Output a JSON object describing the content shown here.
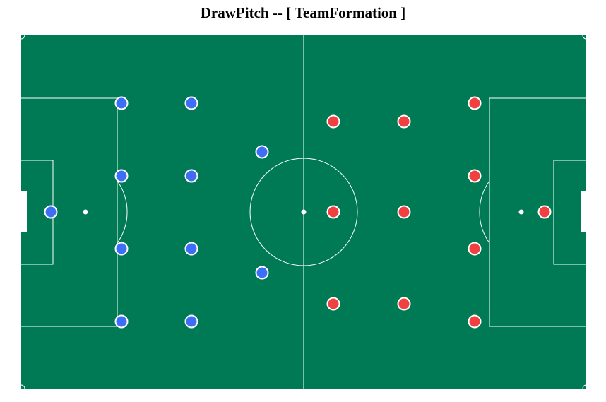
{
  "title": "DrawPitch -- [ TeamFormation ]",
  "colors": {
    "pitch": "#007a55",
    "lines": "#ffffff",
    "home_team": "#3d6ef5",
    "away_team": "#f04040",
    "page_background": "#ffffff"
  },
  "teams": [
    {
      "side": "left",
      "color_key": "home_team",
      "players": 11
    },
    {
      "side": "right",
      "color_key": "away_team",
      "players": 11
    }
  ]
}
